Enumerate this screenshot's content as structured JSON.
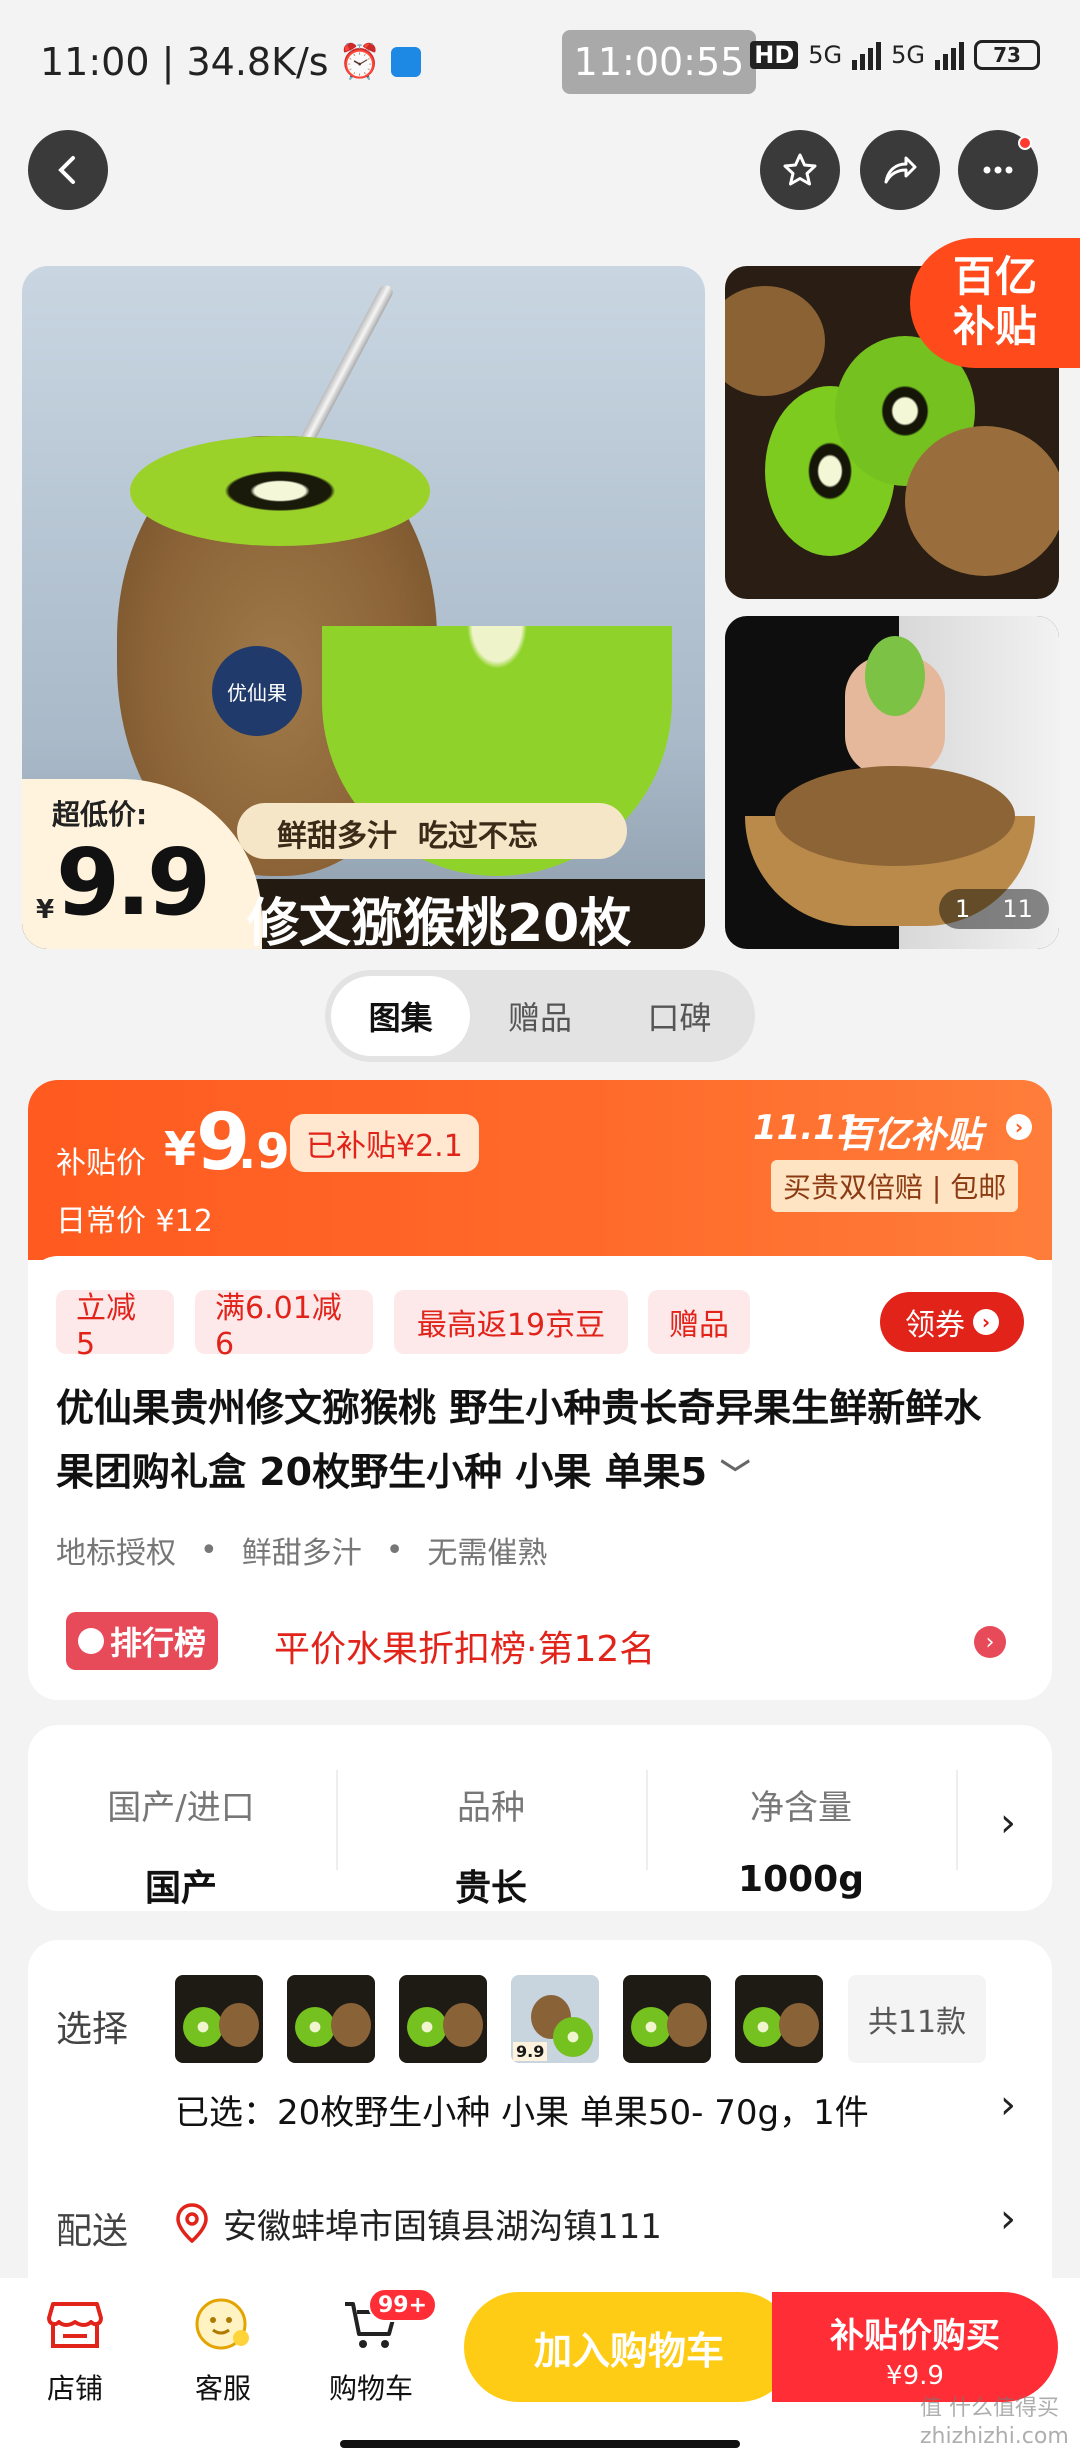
{
  "status_bar": {
    "left_text": "11:00 | 34.8K/s",
    "center_time": "11:00:55",
    "network_1": "5G",
    "network_2": "5G",
    "hd_label": "HD",
    "battery": "73"
  },
  "gallery": {
    "main_badge_label": "超低价:",
    "main_price_symbol": "¥",
    "main_price": "9.9",
    "main_slogan": "鲜甜多汁  吃过不忘",
    "main_title": "修文猕猴桃20枚",
    "brand_logo_text": "优仙果",
    "subsidy_badge_line1": "百亿",
    "subsidy_badge_line2": "补贴",
    "page_indicator_current": "1",
    "page_indicator_total": "11"
  },
  "tabs": [
    {
      "label": "图集",
      "active": true
    },
    {
      "label": "赠品",
      "active": false
    },
    {
      "label": "口碑",
      "active": false
    }
  ],
  "price": {
    "subsidy_label": "补贴价",
    "symbol": "¥",
    "value_int": "9",
    "value_dec": ".9",
    "subsidized_tag": "已补贴¥2.1",
    "daily_label": "日常价 ¥12",
    "promo_1111": "11.11",
    "promo_brand": "百亿补贴",
    "promo_sub": "买贵双倍赔 | 包邮"
  },
  "coupons": [
    {
      "label": "立减5"
    },
    {
      "label": "满6.01减6"
    },
    {
      "label": "最高返19京豆"
    },
    {
      "label": "赠品"
    }
  ],
  "coupon_button": "领券",
  "product": {
    "title": "优仙果贵州修文猕猴桃 野生小种贵长奇异果生鲜新鲜水果团购礼盒 20枚野生小种 小果 单果5",
    "tags": [
      "地标授权",
      "鲜甜多汁",
      "无需催熟"
    ],
    "rank_badge": "排行榜",
    "rank_text": "平价水果折扣榜·第12名"
  },
  "specs": [
    {
      "key": "国产/进口",
      "value": "国产"
    },
    {
      "key": "品种",
      "value": "贵长"
    },
    {
      "key": "净含量",
      "value": "1000g"
    }
  ],
  "select": {
    "label": "选择",
    "count_label": "共11款",
    "selected_text": "已选：20枚野生小种 小果 单果50- 70g，1件",
    "thumb_price_tag": "9.9"
  },
  "delivery": {
    "label": "配送",
    "address": "安徽蚌埠市固镇县湖沟镇111"
  },
  "bottom_bar": {
    "shop": "店铺",
    "service": "客服",
    "cart": "购物车",
    "cart_badge": "99+",
    "add_to_cart": "加入购物车",
    "buy_line1": "补贴价购买",
    "buy_line2": "¥9.9"
  },
  "watermark": "值 什么值得买 zhizhizhi.com",
  "colors": {
    "accent": "#ff5a1f",
    "red": "#e2231a",
    "yellow_btn": "#ffcc15",
    "buy_btn": "#ff2d35"
  }
}
